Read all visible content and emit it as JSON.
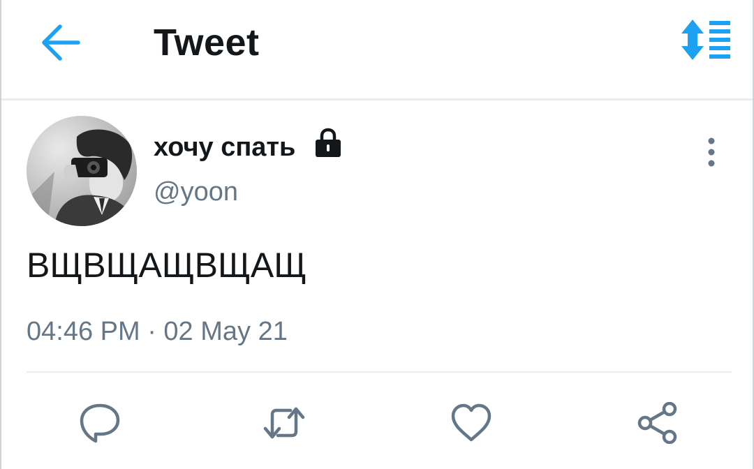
{
  "header": {
    "title": "Tweet",
    "back_icon": "arrow-left-icon",
    "sort_icon": "sort-order-icon"
  },
  "tweet": {
    "author": {
      "display_name": "хочу спать",
      "handle": "@yoon",
      "protected_icon": "lock-icon"
    },
    "text": "ВЩВЩАЩВЩАЩ",
    "timestamp": "04:46 PM · 02 May 21",
    "actions": [
      {
        "name": "reply",
        "icon": "speech-bubble-icon"
      },
      {
        "name": "retweet",
        "icon": "retweet-icon"
      },
      {
        "name": "like",
        "icon": "heart-icon"
      },
      {
        "name": "share",
        "icon": "share-icon"
      }
    ]
  },
  "colors": {
    "accent": "#1da1f2",
    "text_primary": "#14171a",
    "text_secondary": "#657786",
    "icon_gray": "#657786",
    "divider": "#e6ecf0"
  }
}
